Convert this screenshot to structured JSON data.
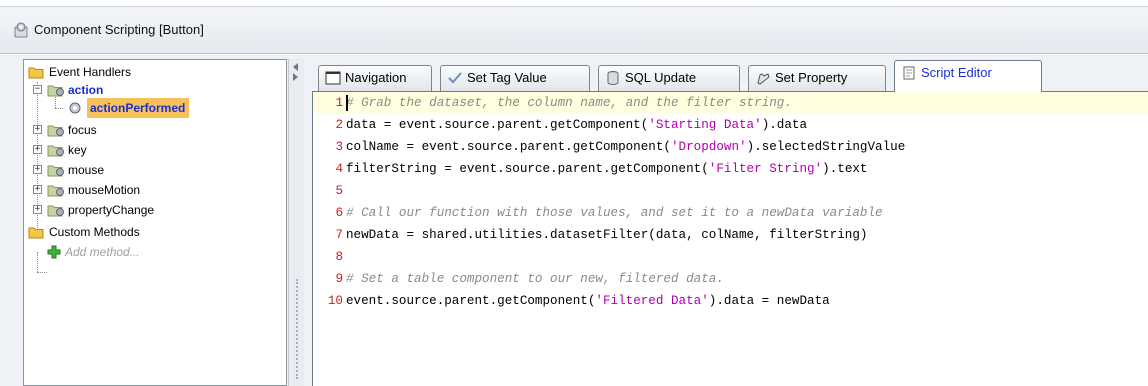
{
  "window": {
    "title": "Component Scripting [Button]"
  },
  "tree": {
    "event_handlers_label": "Event Handlers",
    "action_label": "action",
    "action_performed_label": "actionPerformed",
    "focus_label": "focus",
    "key_label": "key",
    "mouse_label": "mouse",
    "mouse_motion_label": "mouseMotion",
    "property_change_label": "propertyChange",
    "custom_methods_label": "Custom Methods",
    "add_method_label": "Add method..."
  },
  "tabs": {
    "navigation": "Navigation",
    "set_tag_value": "Set Tag Value",
    "sql_update": "SQL Update",
    "set_property": "Set Property",
    "script_editor": "Script Editor"
  },
  "editor": {
    "lines": [
      {
        "num": "1",
        "kind": "comment",
        "text": "# Grab the dataset, the column name, and the filter string."
      },
      {
        "num": "2",
        "pre": "data = event.source.parent.getComponent(",
        "str": "'Starting Data'",
        "post": ").data"
      },
      {
        "num": "3",
        "pre": "colName = event.source.parent.getComponent(",
        "str": "'Dropdown'",
        "post": ").selectedStringValue"
      },
      {
        "num": "4",
        "pre": "filterString = event.source.parent.getComponent(",
        "str": "'Filter String'",
        "post": ").text"
      },
      {
        "num": "5",
        "pre": "",
        "str": "",
        "post": ""
      },
      {
        "num": "6",
        "kind": "comment",
        "text": "# Call our function with those values, and set it to a newData variable"
      },
      {
        "num": "7",
        "pre": "newData = shared.utilities.datasetFilter(data, colName, filterString)",
        "str": "",
        "post": ""
      },
      {
        "num": "8",
        "pre": "",
        "str": "",
        "post": ""
      },
      {
        "num": "9",
        "kind": "comment",
        "text": "# Set a table component to our new, filtered data."
      },
      {
        "num": "10",
        "pre": "event.source.parent.getComponent(",
        "str": "'Filtered Data'",
        "post": ").data = newData"
      }
    ]
  }
}
